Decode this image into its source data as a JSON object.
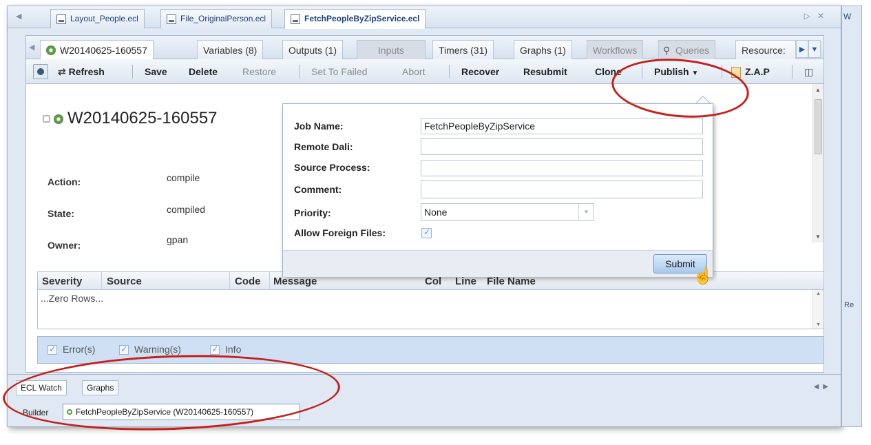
{
  "editor_tabs": [
    {
      "label": "Layout_People.ecl"
    },
    {
      "label": "File_OriginalPerson.ecl"
    },
    {
      "label": "FetchPeopleByZipService.ecl"
    }
  ],
  "right_strip": {
    "tab_label": "W",
    "lower_label": "Re"
  },
  "workunit_tabs": {
    "items": [
      "W20140625-160557",
      "Variables (8)",
      "Outputs (1)",
      "Inputs",
      "Timers (31)",
      "Graphs (1)",
      "Workflows",
      "Queries",
      "Resource:"
    ]
  },
  "toolbar": {
    "refresh": "Refresh",
    "save": "Save",
    "delete": "Delete",
    "restore": "Restore",
    "set_to_failed": "Set To Failed",
    "abort": "Abort",
    "recover": "Recover",
    "resubmit": "Resubmit",
    "clone": "Clone",
    "publish": "Publish",
    "zap": "Z.A.P"
  },
  "summary": {
    "wuid": "W20140625-160557",
    "action_label": "Action:",
    "action_value": "compile",
    "state_label": "State:",
    "state_value": "compiled",
    "owner_label": "Owner:",
    "owner_value": "gpan"
  },
  "publish_dialog": {
    "job_name_label": "Job Name:",
    "job_name_value": "FetchPeopleByZipService",
    "remote_dali_label": "Remote Dali:",
    "remote_dali_value": "",
    "source_process_label": "Source Process:",
    "source_process_value": "",
    "comment_label": "Comment:",
    "comment_value": "",
    "priority_label": "Priority:",
    "priority_value": "None",
    "allow_foreign_label": "Allow Foreign Files:",
    "allow_foreign_checked": true,
    "submit_label": "Submit"
  },
  "messages_grid": {
    "columns": [
      "Severity",
      "Source",
      "Code",
      "Message",
      "Col",
      "Line",
      "File Name"
    ],
    "empty_text": "...Zero Rows..."
  },
  "filters": {
    "errors": "Error(s)",
    "warnings": "Warning(s)",
    "info": "Info"
  },
  "bottom_views": {
    "tabs": [
      "ECL Watch",
      "Graphs"
    ],
    "builder_label": "Builder",
    "builder_value": "FetchPeopleByZipService (W20140625-160557)"
  },
  "colors": {
    "annotation_red": "#c5201b",
    "panel_blue": "#dfe8f3",
    "accent_green": "#4fa13d"
  }
}
